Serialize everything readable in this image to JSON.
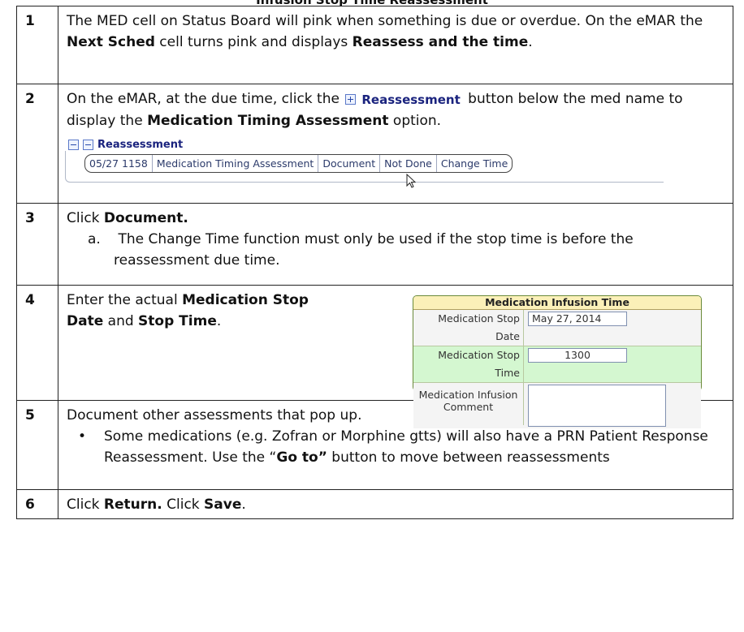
{
  "title": "Infusion Stop Time Reassessment",
  "steps": [
    {
      "num": "1",
      "t1": "The MED cell on Status Board will pink when something is due or overdue.  On the eMAR the ",
      "b1": "Next Sched",
      "t2": " cell turns pink and displays ",
      "b2": "Reassess and the time",
      "t3": "."
    },
    {
      "num": "2",
      "t1": "On the eMAR, at the due time, click the ",
      "btn_label": "Reassessment",
      "t2": " button below the med name to display the ",
      "b1": "Medication Timing Assessment",
      "t3": " option.",
      "panel": {
        "header": "Reassessment",
        "pill": [
          "05/27 1158",
          "Medication Timing Assessment",
          "Document",
          "Not Done",
          "Change Time"
        ]
      }
    },
    {
      "num": "3",
      "t1": "Click ",
      "b1": "Document.",
      "sub_marker": "a.",
      "sub_text": "The Change Time function must only be used if the stop time is before the reassessment due time."
    },
    {
      "num": "4",
      "t1": "Enter the actual ",
      "b1": "Medication Stop Date",
      "t2": " and ",
      "b2": "Stop Time",
      "t3": ".",
      "form": {
        "title": "Medication Infusion Time",
        "rows": [
          {
            "label": "Medication Stop Date",
            "value": "May 27, 2014"
          },
          {
            "label": "Medication Stop Time",
            "value": "1300"
          },
          {
            "label": "Medication Infusion Comment",
            "value": ""
          }
        ]
      }
    },
    {
      "num": "5",
      "t1": "Document other assessments that pop up.",
      "bullet_t1": "Some medications (e.g. Zofran or Morphine gtts) will also have a PRN Patient Response Reassessment. Use the “",
      "bullet_b1": "Go to”",
      "bullet_t2": " button to move between reassessments"
    },
    {
      "num": "6",
      "t1": "Click ",
      "b1": "Return.",
      "t2": " Click ",
      "b2": "Save",
      "t3": "."
    }
  ]
}
